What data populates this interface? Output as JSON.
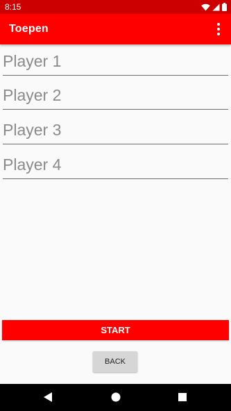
{
  "status_bar": {
    "time": "8:15"
  },
  "app_bar": {
    "title": "Toepen",
    "menu_icon": "overflow-menu-icon"
  },
  "players": [
    {
      "placeholder": "Player 1",
      "value": ""
    },
    {
      "placeholder": "Player 2",
      "value": ""
    },
    {
      "placeholder": "Player 3",
      "value": ""
    },
    {
      "placeholder": "Player 4",
      "value": ""
    }
  ],
  "actions": {
    "start_label": "START",
    "back_label": "BACK"
  },
  "nav_bar": {
    "icons": [
      "back-triangle-icon",
      "home-circle-icon",
      "recents-square-icon"
    ]
  },
  "colors": {
    "status_bar": "#cc0000",
    "app_bar": "#ff0000",
    "start_button": "#ff0000",
    "back_button": "#d6d6d6"
  }
}
